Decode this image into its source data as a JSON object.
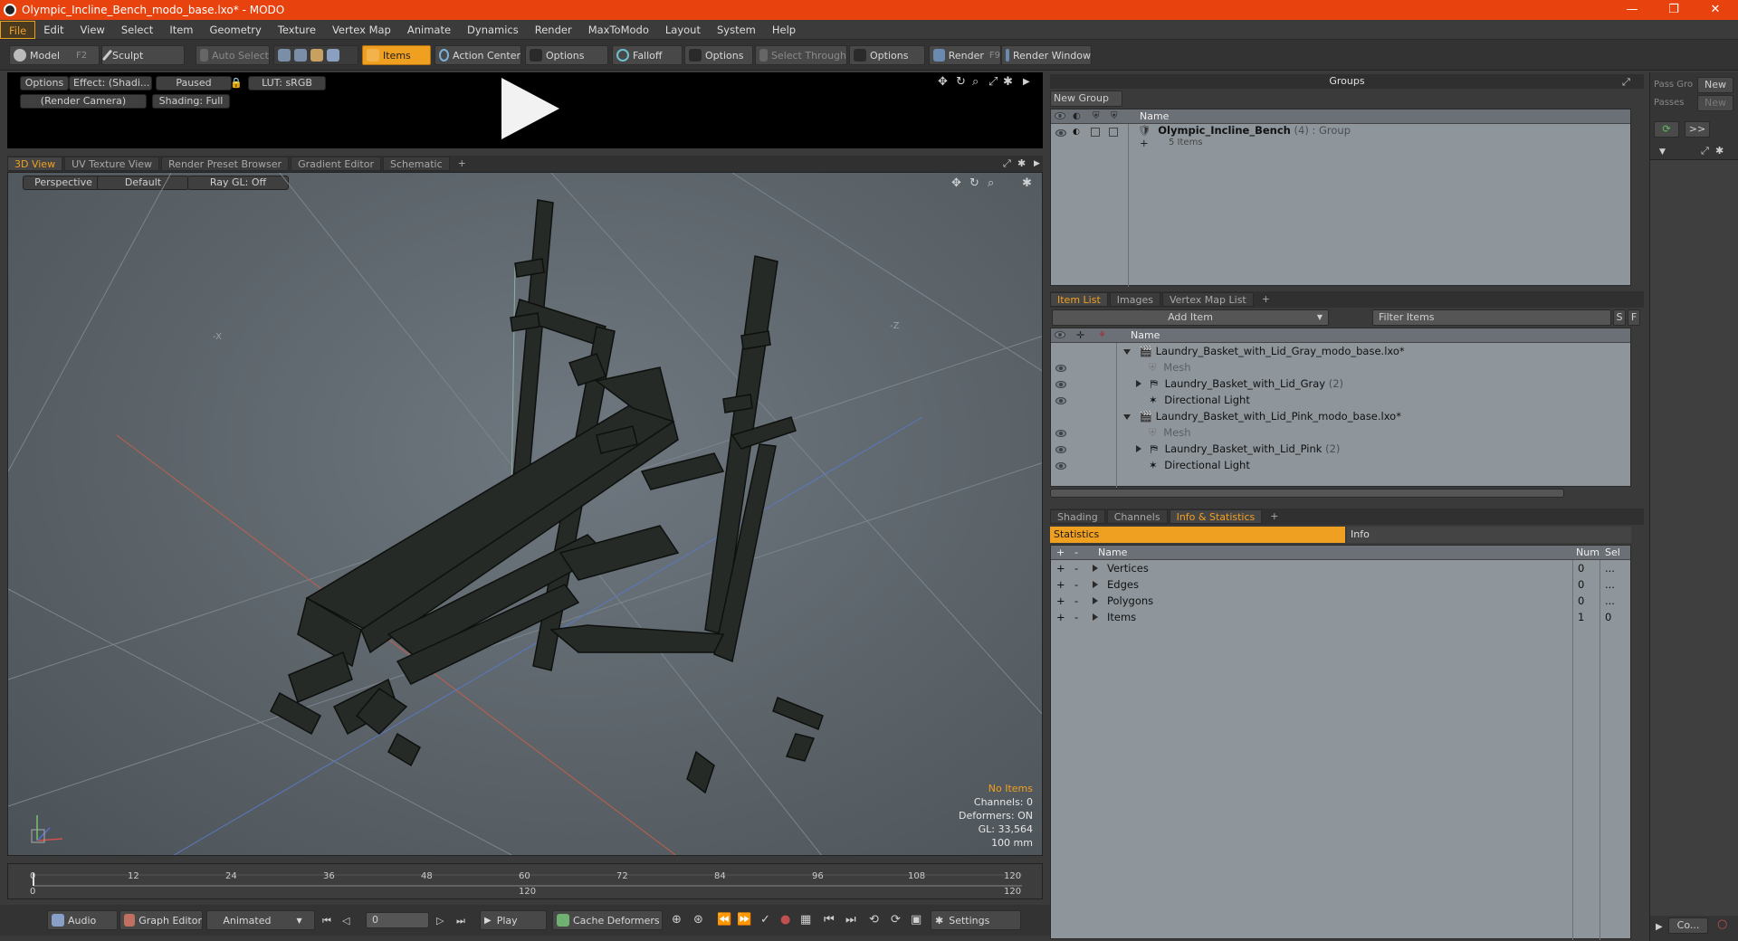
{
  "window": {
    "title": "Olympic_Incline_Bench_modo_base.lxo* - MODO",
    "min": "—",
    "max": "❐",
    "close": "✕"
  },
  "menu": [
    "File",
    "Edit",
    "View",
    "Select",
    "Item",
    "Geometry",
    "Texture",
    "Vertex Map",
    "Animate",
    "Dynamics",
    "Render",
    "MaxToModo",
    "Layout",
    "System",
    "Help"
  ],
  "toolbar": {
    "model": "Model",
    "model_key": "F2",
    "sculpt": "Sculpt",
    "auto_select": "Auto Select",
    "items": "Items",
    "action_center": "Action Center",
    "options1": "Options",
    "falloff": "Falloff",
    "options2": "Options",
    "select_through": "Select Through",
    "options3": "Options",
    "render": "Render",
    "render_key": "F9",
    "render_window": "Render Window"
  },
  "preview": {
    "options": "Options",
    "effect": "Effect: (Shadi...",
    "paused": "Paused",
    "lut": "LUT: sRGB",
    "camera": "(Render Camera)",
    "shading": "Shading: Full"
  },
  "view_tabs": [
    "3D View",
    "UV Texture View",
    "Render Preset Browser",
    "Gradient Editor",
    "Schematic",
    "+"
  ],
  "viewport": {
    "perspective": "Perspective",
    "default": "Default",
    "raygl": "Ray GL: Off",
    "axis_x": "-X",
    "axis_z": "-Z",
    "hud": {
      "no_items": "No Items",
      "channels": "Channels: 0",
      "deformers": "Deformers: ON",
      "gl": "GL: 33,564",
      "scale": "100 mm"
    }
  },
  "timeline": {
    "ticks": [
      "0",
      "12",
      "24",
      "36",
      "48",
      "60",
      "72",
      "84",
      "96",
      "108",
      "120"
    ],
    "start": "0",
    "mid": "120",
    "end": "120"
  },
  "bottom": {
    "audio": "Audio",
    "graph_editor": "Graph Editor",
    "animated": "Animated",
    "frame": "0",
    "play": "Play",
    "cache": "Cache Deformers",
    "settings": "Settings"
  },
  "groups": {
    "title": "Groups",
    "new_group": "New Group",
    "col_name": "Name",
    "item_name": "Olympic_Incline_Bench",
    "item_count": "(4)",
    "item_type": ": Group",
    "item_sub": "5 Items"
  },
  "item_list": {
    "tabs": [
      "Item List",
      "Images",
      "Vertex Map List",
      "+"
    ],
    "add_item": "Add Item",
    "filter": "Filter Items",
    "s": "S",
    "f": "F",
    "col_name": "Name",
    "rows": [
      {
        "label": "Laundry_Basket_with_Lid_Gray_modo_base.lxo*",
        "count": ""
      },
      {
        "label": "Mesh",
        "count": ""
      },
      {
        "label": "Laundry_Basket_with_Lid_Gray",
        "count": "(2)"
      },
      {
        "label": "Directional Light",
        "count": ""
      },
      {
        "label": "Laundry_Basket_with_Lid_Pink_modo_base.lxo*",
        "count": ""
      },
      {
        "label": "Mesh",
        "count": ""
      },
      {
        "label": "Laundry_Basket_with_Lid_Pink",
        "count": "(2)"
      },
      {
        "label": "Directional Light",
        "count": ""
      }
    ]
  },
  "stats": {
    "tabs": [
      "Shading",
      "Channels",
      "Info & Statistics",
      "+"
    ],
    "statistics": "Statistics",
    "info": "Info",
    "col_name": "Name",
    "col_num": "Num",
    "col_sel": "Sel",
    "rows": [
      {
        "name": "Vertices",
        "num": "0",
        "sel": "..."
      },
      {
        "name": "Edges",
        "num": "0",
        "sel": "..."
      },
      {
        "name": "Polygons",
        "num": "0",
        "sel": "..."
      },
      {
        "name": "Items",
        "num": "1",
        "sel": "0"
      }
    ]
  },
  "far_right": {
    "pass_group": "Pass Gro",
    "new1": "New",
    "passes": "Passes",
    "new2": "New",
    "more": ">>",
    "co": "Co..."
  }
}
